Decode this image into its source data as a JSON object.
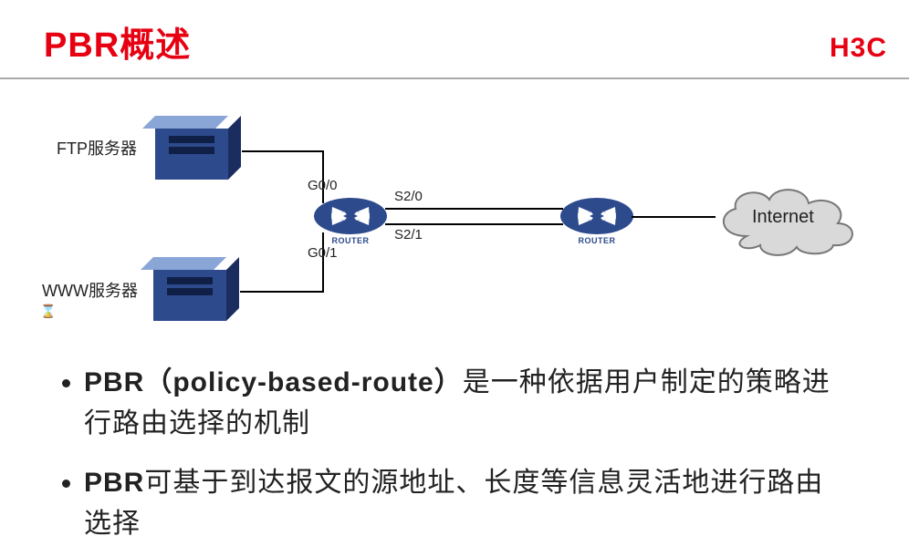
{
  "header": {
    "title": "PBR概述",
    "logo": "H3C"
  },
  "diagram": {
    "server1_label": "FTP服务器",
    "server2_label": "WWW服务器",
    "router_caption": "ROUTER",
    "cloud_label": "Internet",
    "iface_g00": "G0/0",
    "iface_g01": "G0/1",
    "iface_s20": "S2/0",
    "iface_s21": "S2/1"
  },
  "bullets": {
    "b1_lead": "PBR（policy-based-route）",
    "b1_rest": "是一种依据用户制定的策略进行路由选择的机制",
    "b2_lead": "PBR",
    "b2_rest": "可基于到达报文的源地址、长度等信息灵活地进行路由选择"
  },
  "colors": {
    "brand_red": "#e60012",
    "server_blue": "#2d4a8c"
  }
}
